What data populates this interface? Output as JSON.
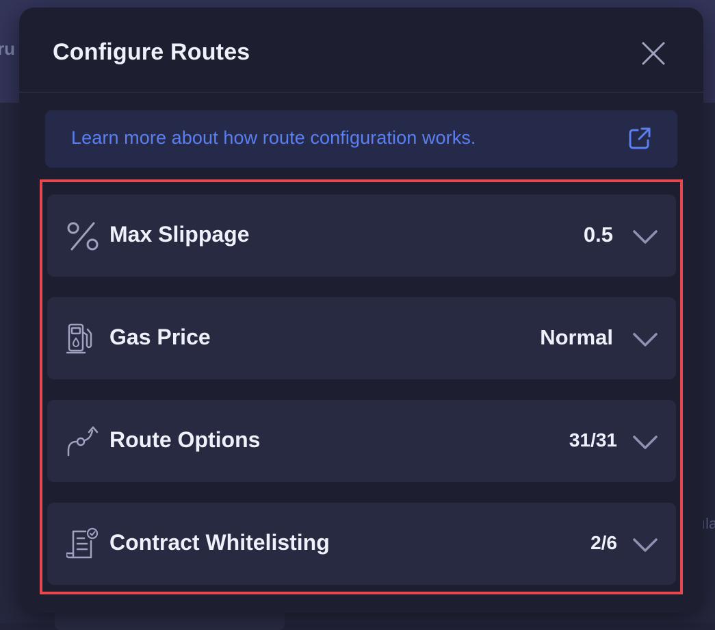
{
  "background": {
    "left_text": "ru",
    "right_text": "ıla"
  },
  "modal": {
    "title": "Configure Routes",
    "close_icon": "close-icon",
    "learn_more": {
      "text": "Learn more about how route configuration works.",
      "icon": "external-link-icon"
    },
    "settings": [
      {
        "label": "Max Slippage",
        "value": "0.5",
        "icon": "percent-icon"
      },
      {
        "label": "Gas Price",
        "value": "Normal",
        "icon": "gas-pump-icon"
      },
      {
        "label": "Route Options",
        "value": "31/31",
        "icon": "route-icon"
      },
      {
        "label": "Contract Whitelisting",
        "value": "2/6",
        "icon": "contract-check-icon"
      }
    ]
  },
  "colors": {
    "accent_link": "#5b7ff0",
    "highlight_border": "#e5484d",
    "modal_bg": "#1d1f31",
    "row_bg": "#272a40"
  }
}
